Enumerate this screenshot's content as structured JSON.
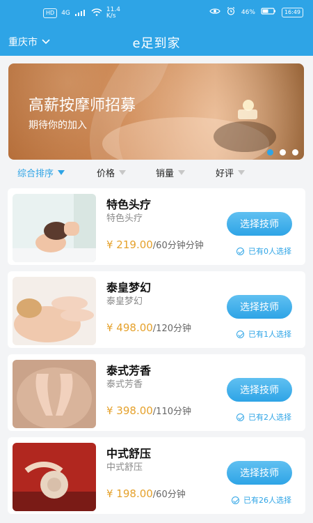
{
  "status_bar": {
    "left": {
      "sim_label": "HD",
      "network_label": "4G",
      "speed_value": "11.4",
      "speed_unit": "K/s"
    },
    "right": {
      "battery_percent": "46%",
      "time": "16:49"
    }
  },
  "header": {
    "city": "重庆市",
    "title": "e足到家"
  },
  "banner": {
    "title": "高薪按摩师招募",
    "subtitle": "期待你的加入",
    "dots_count": 3,
    "active_dot_index": 0
  },
  "sort": {
    "items": [
      "综合排序",
      "价格",
      "销量",
      "好评"
    ],
    "active_index": 0
  },
  "services": [
    {
      "name": "特色头疗",
      "subtitle": "特色头疗",
      "price": "¥ 219.00",
      "unit": "/60分钟分钟",
      "button": "选择技师",
      "selected": "已有0人选择"
    },
    {
      "name": "泰皇梦幻",
      "subtitle": "泰皇梦幻",
      "price": "¥ 498.00",
      "unit": "/120分钟",
      "button": "选择技师",
      "selected": "已有1人选择"
    },
    {
      "name": "泰式芳香",
      "subtitle": "泰式芳香",
      "price": "¥ 398.00",
      "unit": "/110分钟",
      "button": "选择技师",
      "selected": "已有2人选择"
    },
    {
      "name": "中式舒压",
      "subtitle": "中式舒压",
      "price": "¥ 198.00",
      "unit": "/60分钟",
      "button": "选择技师",
      "selected": "已有26人选择"
    }
  ],
  "colors": {
    "primary": "#2ea4e6",
    "price": "#e5a12b",
    "page_bg": "#f3f4f6"
  }
}
